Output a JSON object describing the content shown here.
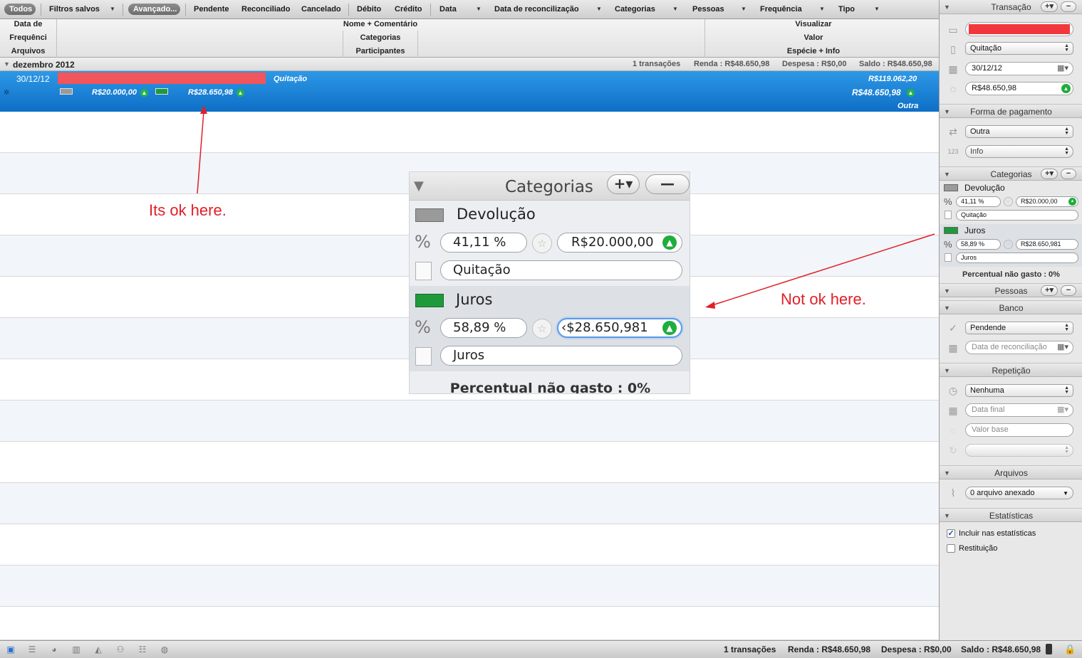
{
  "filters": {
    "todos": "Todos",
    "filtros_salvos": "Filtros salvos",
    "avancado": "Avançado...",
    "pendente": "Pendente",
    "reconciliado": "Reconciliado",
    "cancelado": "Cancelado",
    "debito": "Débito",
    "credito": "Crédito",
    "data": "Data",
    "data_reconciliacao": "Data de reconcilização",
    "categorias": "Categorias",
    "pessoas": "Pessoas",
    "frequencia": "Frequência",
    "tipo": "Tipo"
  },
  "columns": {
    "col1": [
      "Data de",
      "Frequênci",
      "Arquivos"
    ],
    "col2": [
      "Nome + Comentário",
      "Categorias",
      "Participantes"
    ],
    "col3": [
      "Visualizar",
      "Valor",
      "Espécie + Info"
    ]
  },
  "group": {
    "title": "dezembro 2012",
    "count": "1 transações",
    "renda": "Renda : R$48.650,98",
    "despesa": "Despesa : R$0,00",
    "saldo": "Saldo : R$48.650,98"
  },
  "transaction": {
    "date": "30/12/12",
    "category_note": "Quitação",
    "running_total": "R$119.062,20",
    "split1_amount": "R$20.000,00",
    "split2_amount": "R$28.650,98",
    "amount": "R$48.650,98",
    "type": "Outra",
    "name_redacted_color": "#f2555b"
  },
  "zoom": {
    "header": "Categorias",
    "plus_label": "+▾",
    "minus_label": "—",
    "cat1": {
      "name": "Devolução",
      "percent": "41,11 %",
      "value": "R$20.000,00",
      "note": "Quitação",
      "color": "#9a9a9a"
    },
    "cat2": {
      "name": "Juros",
      "percent": "58,89 %",
      "value": "‹$28.650,981",
      "note": "Juros",
      "color": "#1f9a3a"
    },
    "footer": "Percentual não gasto : 0%"
  },
  "annotations": {
    "ok": "Its ok here.",
    "not_ok": "Not ok here.",
    "color": "#e01f26"
  },
  "inspector": {
    "transacao": {
      "title": "Transação",
      "tipo": "Quitação",
      "data": "30/12/12",
      "valor": "R$48.650,98"
    },
    "forma_pagamento": {
      "title": "Forma de pagamento",
      "metodo": "Outra",
      "info_placeholder": "Info"
    },
    "categorias": {
      "title": "Categorias",
      "items": [
        {
          "name": "Devolução",
          "percent": "41,11 %",
          "value": "R$20.000,00",
          "note": "Quitação",
          "color": "#9a9a9a"
        },
        {
          "name": "Juros",
          "percent": "58,89 %",
          "value": "R$28.650,981",
          "note": "Juros",
          "color": "#1f9a3a"
        }
      ],
      "footer": "Percentual não gasto : 0%"
    },
    "pessoas": {
      "title": "Pessoas"
    },
    "banco": {
      "title": "Banco",
      "status": "Pendende",
      "data_reconciliacao_placeholder": "Data de reconciliação"
    },
    "repeticao": {
      "title": "Repetição",
      "frequencia": "Nenhuma",
      "data_final_placeholder": "Data final",
      "valor_base_placeholder": "Valor base"
    },
    "arquivos": {
      "title": "Arquivos",
      "anexos": "0 arquivo anexado"
    },
    "estatisticas": {
      "title": "Estatísticas",
      "incluir": "Incluir nas estatísticas",
      "incluir_checked": true,
      "restituicao": "Restituição",
      "restituicao_checked": false
    }
  },
  "status": {
    "count": "1 transações",
    "renda": "Renda : R$48.650,98",
    "despesa": "Despesa : R$0,00",
    "saldo": "Saldo : R$48.650,98"
  }
}
